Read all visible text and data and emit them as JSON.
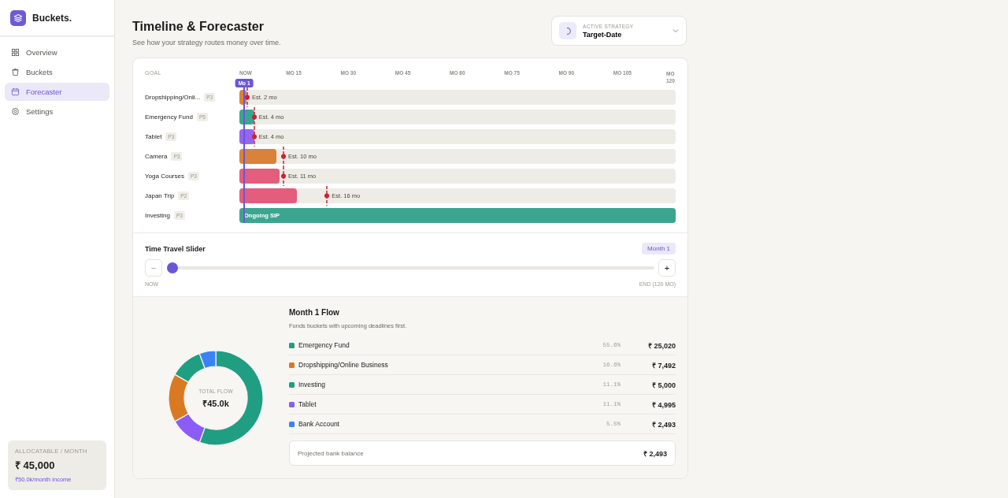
{
  "sidebar": {
    "brand": "Buckets.",
    "items": [
      {
        "label": "Overview",
        "selected": false
      },
      {
        "label": "Buckets",
        "selected": false
      },
      {
        "label": "Forecaster",
        "selected": true
      },
      {
        "label": "Settings",
        "selected": false
      }
    ],
    "allocatable": {
      "label": "ALLOCATABLE / MONTH",
      "amount": "₹ 45,000",
      "income": "₹50.0k/month income"
    }
  },
  "header": {
    "title": "Timeline & Forecaster",
    "subtitle": "See how your strategy routes money over time.",
    "strategy": {
      "label": "ACTIVE STRATEGY",
      "value": "Target-Date"
    }
  },
  "timeline": {
    "goal_heading": "GOAL",
    "ticks": [
      "NOW",
      "MO 15",
      "MO 30",
      "MO 45",
      "MO 60",
      "MO 75",
      "MO 90",
      "MO 105",
      "MO 120"
    ],
    "current": {
      "label": "Mo 1",
      "level": 0.011
    },
    "goals": [
      {
        "name": "Dropshipping/Onli...",
        "priority": "P3",
        "kind": "target",
        "color": "#d9823b",
        "level": 0.016,
        "bar_label": "Est. 2 mo",
        "deadline": {
          "level": 0.018
        }
      },
      {
        "name": "Emergency Fund",
        "priority": "P5",
        "kind": "target",
        "color": "#3ca58f",
        "level": 0.034,
        "bar_label": "Est. 4 mo",
        "deadline": {
          "level": 0.034
        }
      },
      {
        "name": "Tablet",
        "priority": "P3",
        "kind": "target",
        "color": "#9466ee",
        "level": 0.034,
        "bar_label": "Est. 4 mo",
        "deadline": {
          "level": 0.034
        }
      },
      {
        "name": "Camera",
        "priority": "P3",
        "kind": "target",
        "color": "#d9823b",
        "level": 0.085,
        "bar_label": "Est. 10 mo",
        "deadline": {
          "level": 0.101
        }
      },
      {
        "name": "Yoga Courses",
        "priority": "P3",
        "kind": "target",
        "color": "#e35d7d",
        "level": 0.092,
        "bar_label": "Est. 11 mo",
        "deadline": {
          "level": 0.101
        }
      },
      {
        "name": "Japan Trip",
        "priority": "P2",
        "kind": "target",
        "color": "#e35d7d",
        "level": 0.132,
        "bar_label": "Est. 16 mo",
        "deadline": {
          "level": 0.201
        }
      },
      {
        "name": "Investing",
        "priority": "P3",
        "kind": "ongoing",
        "color": "#3ca58f",
        "level": 1,
        "bar_label": "Ongoing SIP"
      }
    ]
  },
  "slider": {
    "title": "Time Travel Slider",
    "badge": "Month 1",
    "minus": "−",
    "plus": "+",
    "level": 0,
    "start_label": "NOW",
    "end_label": "END (120 MO)"
  },
  "flow": {
    "title": "Month 1 Flow",
    "subtitle": "Funds buckets with upcoming deadlines first.",
    "center_label": "TOTAL FLOW",
    "center_value": "₹45.0k",
    "chart_data": {
      "type": "donut",
      "values": [
        55.6,
        11.1,
        16.6,
        11.1,
        5.6
      ],
      "colors": [
        "#1f9e82",
        "#8b5cf6",
        "#d97a22",
        "#1f9e82",
        "#3b82f6"
      ]
    },
    "rows": [
      {
        "name": "Emergency Fund",
        "color": "#1f9e82",
        "percent": "55.6%",
        "amount": "₹ 25,020"
      },
      {
        "name": "Dropshipping/Online Business",
        "color": "#d97a22",
        "percent": "16.6%",
        "amount": "₹ 7,492"
      },
      {
        "name": "Investing",
        "color": "#1f9e82",
        "percent": "11.1%",
        "amount": "₹ 5,000"
      },
      {
        "name": "Tablet",
        "color": "#8b5cf6",
        "percent": "11.1%",
        "amount": "₹ 4,995"
      },
      {
        "name": "Bank Account",
        "color": "#3b82f6",
        "percent": "5.5%",
        "amount": "₹ 2,493"
      }
    ],
    "projected": {
      "label": "Projected bank balance",
      "amount": "₹ 2,493"
    }
  }
}
